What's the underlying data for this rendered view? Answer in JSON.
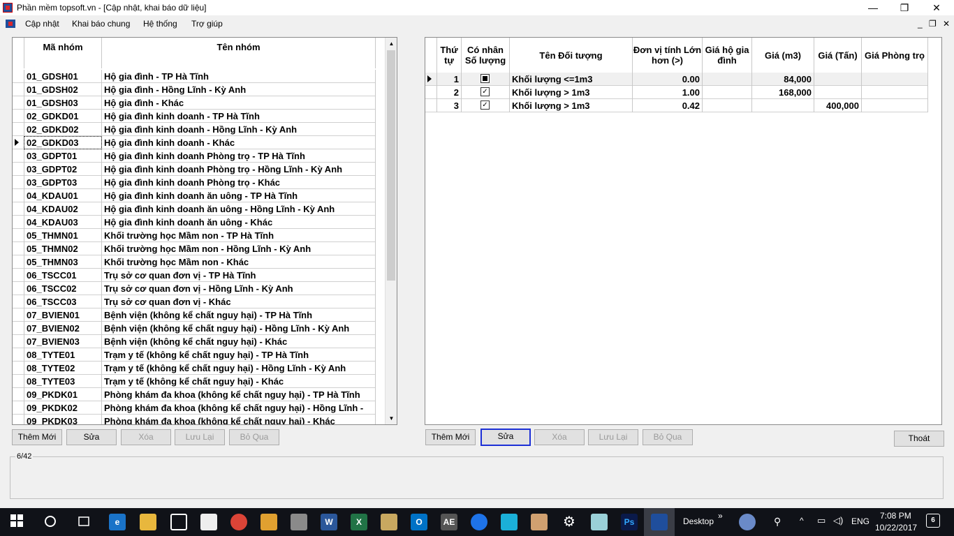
{
  "window": {
    "title": "Phần mềm topsoft.vn - [Cập nhật, khai báo dữ liệu]",
    "minimize": "—",
    "maximize": "❐",
    "close": "✕",
    "icon": "app-icon"
  },
  "menu": {
    "items": [
      "Cập nhật",
      "Khai báo chung",
      "Hệ thống",
      "Trợ giúp"
    ],
    "mdi_minimize": "_",
    "mdi_restore": "❐",
    "mdi_close": "✕"
  },
  "left_grid": {
    "headers": [
      "Mã nhóm",
      "Tên nhóm"
    ],
    "rows": [
      [
        "01_GDSH01",
        "Hộ gia đình - TP Hà Tĩnh"
      ],
      [
        "01_GDSH02",
        "Hộ gia đình - Hồng Lĩnh - Kỳ Anh"
      ],
      [
        "01_GDSH03",
        "Hộ gia đình - Khác"
      ],
      [
        "02_GDKD01",
        "Hộ gia đình kinh doanh - TP Hà Tĩnh"
      ],
      [
        "02_GDKD02",
        "Hộ gia đình kinh doanh - Hồng Lĩnh - Kỳ Anh"
      ],
      [
        "02_GDKD03",
        "Hộ gia đình kinh doanh - Khác"
      ],
      [
        "03_GDPT01",
        "Hộ gia đình kinh doanh Phòng trọ - TP Hà Tĩnh"
      ],
      [
        "03_GDPT02",
        "Hộ gia đình kinh doanh Phòng trọ - Hồng Lĩnh - Kỳ Anh"
      ],
      [
        "03_GDPT03",
        "Hộ gia đình kinh doanh Phòng trọ - Khác"
      ],
      [
        "04_KDAU01",
        "Hộ gia đình kinh doanh ăn uông - TP Hà Tĩnh"
      ],
      [
        "04_KDAU02",
        "Hộ gia đình kinh doanh ăn uông - Hồng Lĩnh - Kỳ Anh"
      ],
      [
        "04_KDAU03",
        "Hộ gia đình kinh doanh ăn uông - Khác"
      ],
      [
        "05_THMN01",
        "Khối trường học Mầm non - TP Hà Tĩnh"
      ],
      [
        "05_THMN02",
        "Khối trường học Mầm non - Hồng Lĩnh - Kỳ Anh"
      ],
      [
        "05_THMN03",
        "Khối trường học Mầm non - Khác"
      ],
      [
        "06_TSCC01",
        "Trụ sở cơ quan đơn vị - TP Hà Tĩnh"
      ],
      [
        "06_TSCC02",
        "Trụ sở cơ quan đơn vị - Hồng Lĩnh - Kỳ Anh"
      ],
      [
        "06_TSCC03",
        "Trụ sở cơ quan đơn vị - Khác"
      ],
      [
        "07_BVIEN01",
        "Bệnh viện (không kể chất nguy hại) - TP Hà Tĩnh"
      ],
      [
        "07_BVIEN02",
        "Bệnh viện (không kể chất nguy hại) - Hồng Lĩnh - Kỳ Anh"
      ],
      [
        "07_BVIEN03",
        "Bệnh viện (không kể chất nguy hại) - Khác"
      ],
      [
        "08_TYTE01",
        "Trạm y tế (không kể chất nguy hại) - TP Hà Tĩnh"
      ],
      [
        "08_TYTE02",
        "Trạm y tế (không kể chất nguy hại) - Hồng Lĩnh - Kỳ Anh"
      ],
      [
        "08_TYTE03",
        "Trạm y tế (không kể chất nguy hại) - Khác"
      ],
      [
        "09_PKDK01",
        "Phòng khám đa khoa (không kể chất nguy hại) - TP Hà Tĩnh"
      ],
      [
        "09_PKDK02",
        "Phòng khám đa khoa (không kể chất nguy hại) - Hồng Lĩnh -"
      ],
      [
        "09_PKDK03",
        "Phòng khám đa khoa (không kể chất nguy hại) - Khác"
      ]
    ],
    "current_row_index": 5
  },
  "right_grid": {
    "headers": {
      "thu_tu": "Thứ tự",
      "co_nhan": "Có nhân Số lượng",
      "ten_doi_tuong": "Tên Đối tượng",
      "don_vi_tinh": "Đơn vị tính Lớn hơn (>)",
      "gia_ho_gia_dinh": "Giá hộ gia đình",
      "gia_m3": "Giá (m3)",
      "gia_tan": "Giá (Tấn)",
      "gia_phong_tro": "Giá Phòng trọ"
    },
    "rows": [
      {
        "thu_tu": "1",
        "checked": "indeterminate",
        "ten": "Khối lượng <=1m3",
        "lon_hon": "0.00",
        "gia_hgd": "",
        "gia_m3": "84,000",
        "gia_tan": "",
        "gia_pt": ""
      },
      {
        "thu_tu": "2",
        "checked": "checked",
        "ten": "Khối lượng > 1m3",
        "lon_hon": "1.00",
        "gia_hgd": "",
        "gia_m3": "168,000",
        "gia_tan": "",
        "gia_pt": ""
      },
      {
        "thu_tu": "3",
        "checked": "checked",
        "ten": "Khối lượng > 1m3",
        "lon_hon": "0.42",
        "gia_hgd": "",
        "gia_m3": "",
        "gia_tan": "400,000",
        "gia_pt": ""
      }
    ]
  },
  "left_buttons": {
    "add": "Thêm Mới",
    "edit": "Sửa",
    "delete": "Xóa",
    "save": "Lưu Lại",
    "skip": "Bỏ Qua"
  },
  "right_buttons": {
    "add": "Thêm Mới",
    "edit": "Sửa",
    "delete": "Xóa",
    "save": "Lưu Lại",
    "skip": "Bỏ Qua",
    "exit": "Thoát"
  },
  "status": {
    "record_position": "6/42"
  },
  "taskbar": {
    "desktop_label": "Desktop",
    "chevron": "»",
    "lang": "ENG",
    "time": "7:08 PM",
    "date": "10/22/2017",
    "notification_count": "6",
    "apps": [
      "start-icon",
      "cortana-icon",
      "task-view-icon",
      "edge-icon",
      "file-explorer-icon",
      "store-icon",
      "mail-icon",
      "chrome-icon",
      "tools-icon",
      "settings-tools-icon",
      "word-icon",
      "excel-icon",
      "folder-app-icon",
      "outlook-icon",
      "ae-app-icon",
      "teamviewer-icon",
      "app-icon",
      "paint-icon",
      "gear-icon",
      "notepad-icon",
      "photoshop-icon",
      "topsoft-icon"
    ]
  }
}
